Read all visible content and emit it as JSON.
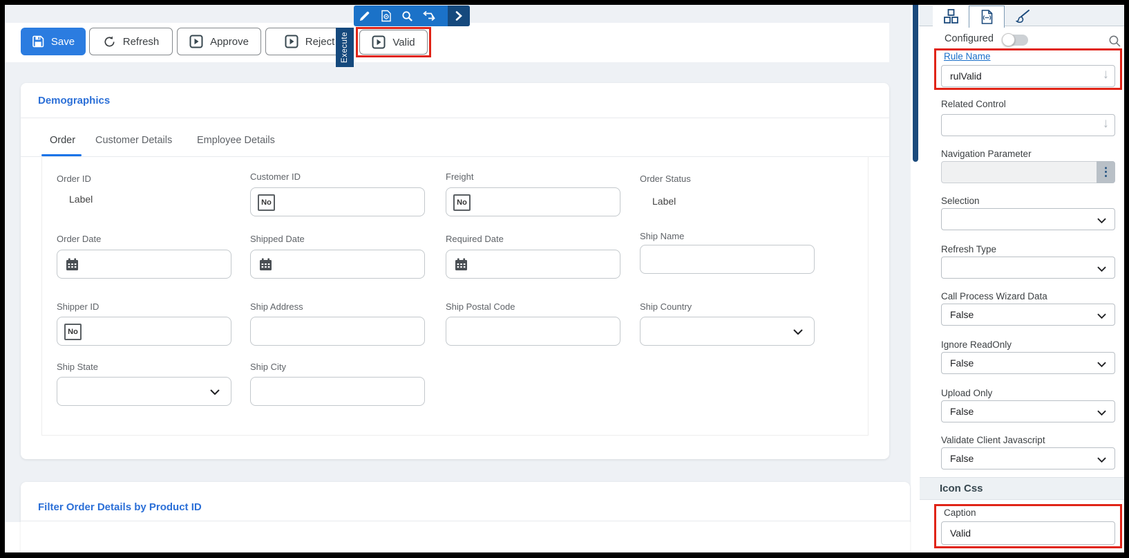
{
  "action_bar": {
    "save": "Save",
    "refresh": "Refresh",
    "approve": "Approve",
    "reject": "Reject",
    "valid": "Valid"
  },
  "execute_tab": {
    "label": "Execute"
  },
  "mini_toolbar": {
    "icons": [
      "pencil",
      "document-gear",
      "search",
      "swap-arrows",
      "chevron-right"
    ]
  },
  "demographics": {
    "title": "Demographics",
    "tabs": [
      {
        "label": "Order",
        "active": true
      },
      {
        "label": "Customer Details",
        "active": false
      },
      {
        "label": "Employee Details",
        "active": false
      }
    ],
    "number_badge": "No",
    "fields": [
      {
        "label": "Order ID",
        "type": "label",
        "value": "Label"
      },
      {
        "label": "Customer ID",
        "type": "number",
        "value": ""
      },
      {
        "label": "Freight",
        "type": "number",
        "value": ""
      },
      {
        "label": "Order Status",
        "type": "label",
        "value": "Label"
      },
      {
        "label": "Order Date",
        "type": "date",
        "value": ""
      },
      {
        "label": "Shipped Date",
        "type": "date",
        "value": ""
      },
      {
        "label": "Required Date",
        "type": "date",
        "value": ""
      },
      {
        "label": "Ship Name",
        "type": "text",
        "value": ""
      },
      {
        "label": "Shipper ID",
        "type": "number",
        "value": ""
      },
      {
        "label": "Ship Address",
        "type": "text",
        "value": ""
      },
      {
        "label": "Ship Postal Code",
        "type": "text",
        "value": ""
      },
      {
        "label": "Ship Country",
        "type": "select",
        "value": ""
      },
      {
        "label": "Ship State",
        "type": "select",
        "value": ""
      },
      {
        "label": "Ship City",
        "type": "text",
        "value": ""
      }
    ]
  },
  "filter_section": {
    "title": "Filter Order Details by Product ID"
  },
  "properties_panel": {
    "tabs": [
      "hierarchy",
      "code-document",
      "paintbrush"
    ],
    "configured_label": "Configured",
    "rule_name": {
      "label": "Rule Name",
      "value": "rulValid"
    },
    "related_control": {
      "label": "Related Control",
      "value": ""
    },
    "navigation_parameter": {
      "label": "Navigation Parameter",
      "value": ""
    },
    "selection": {
      "label": "Selection",
      "value": ""
    },
    "refresh_type": {
      "label": "Refresh Type",
      "value": ""
    },
    "call_process_wizard_data": {
      "label": "Call Process Wizard Data",
      "value": "False"
    },
    "ignore_readonly": {
      "label": "Ignore ReadOnly",
      "value": "False"
    },
    "upload_only": {
      "label": "Upload Only",
      "value": "False"
    },
    "validate_client_javascript": {
      "label": "Validate Client Javascript",
      "value": "False"
    },
    "icon_css_header": "Icon Css",
    "caption": {
      "label": "Caption",
      "value": "Valid"
    }
  },
  "icons": {
    "lookup_arrow": "↓",
    "ellipsis": "⋮"
  },
  "colors": {
    "accent_blue": "#2b7ce0",
    "toolbar_blue": "#1b72c8",
    "navy": "#15497d",
    "highlight_red": "#e02417",
    "heading_blue": "#2b6fd7"
  }
}
